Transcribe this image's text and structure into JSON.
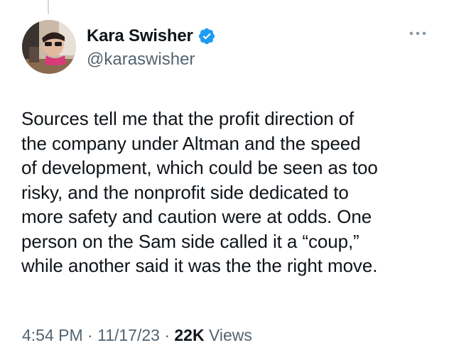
{
  "author": {
    "display_name": "Kara Swisher",
    "handle": "@karaswisher",
    "verified": true,
    "verified_color": "#1d9bf0"
  },
  "tweet": {
    "text_lines": [
      "Sources tell me that the profit direction of",
      "the company under Altman and the speed",
      "of development, which could be seen as too",
      "risky, and the nonprofit side dedicated to",
      "more safety and caution were at odds. One",
      "person on the Sam side called it a “coup,”",
      "while another said it was the the right move."
    ]
  },
  "meta": {
    "time": "4:54 PM",
    "separator": "·",
    "date": "11/17/23",
    "views_count": "22K",
    "views_label": "Views"
  },
  "icons": {
    "verified": "verified-badge-icon",
    "more": "more-options-icon"
  },
  "colors": {
    "text_primary": "#0f1419",
    "text_secondary": "#536471",
    "accent": "#1d9bf0"
  }
}
